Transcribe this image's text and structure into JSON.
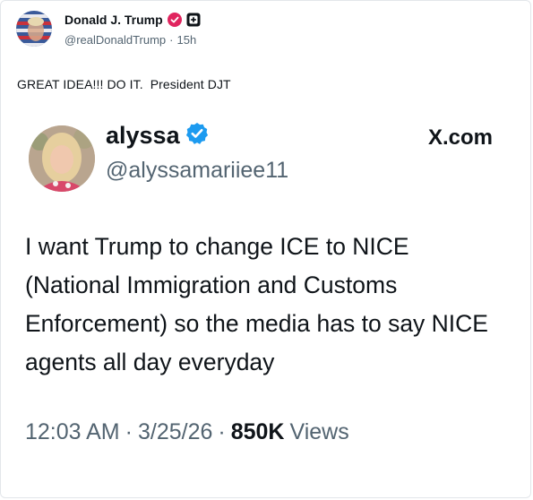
{
  "post": {
    "author_name": "Donald J. Trump",
    "handle": "@realDonaldTrump",
    "separator": "·",
    "time": "15h",
    "text": "GREAT IDEA!!! DO IT.  President DJT"
  },
  "quote": {
    "name": "alyssa",
    "handle": "@alyssamariiee11",
    "brand": "X.com",
    "text": "I want Trump to change ICE to NICE (National Immigration and Customs Enforcement) so the media has to say NICE agents all day everyday",
    "time": "12:03 AM",
    "sep1": "·",
    "date": "3/25/26",
    "sep2": "·",
    "views_count": "850K",
    "views_label": "Views"
  },
  "colors": {
    "text": "#0f1419",
    "muted": "#536471",
    "verified_blue": "#1d9bf0",
    "verified_red": "#e0245e"
  }
}
